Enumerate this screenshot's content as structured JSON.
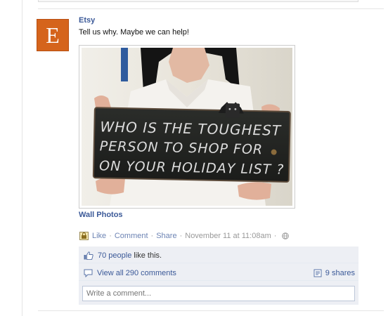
{
  "post": {
    "author": "Etsy",
    "avatar_letter": "E",
    "message": "Tell us why. Maybe we can help!",
    "photo_text_lines": [
      "WHO IS THE TOUGHEST",
      "PERSON TO SHOP FOR",
      "ON YOUR HOLIDAY LIST ?"
    ],
    "album_link": "Wall Photos"
  },
  "actions": {
    "like": "Like",
    "comment": "Comment",
    "share": "Share",
    "timestamp": "November 11 at 11:08am",
    "separator": "·"
  },
  "ufi": {
    "likes_link": "70 people",
    "likes_text": "like this.",
    "view_comments": "View all 290 comments",
    "shares": "9 shares",
    "comment_placeholder": "Write a comment..."
  },
  "colors": {
    "link": "#3b5998",
    "link_light": "#6d84b4",
    "avatar_bg": "#d5641c",
    "ufi_bg": "#edeff4"
  }
}
